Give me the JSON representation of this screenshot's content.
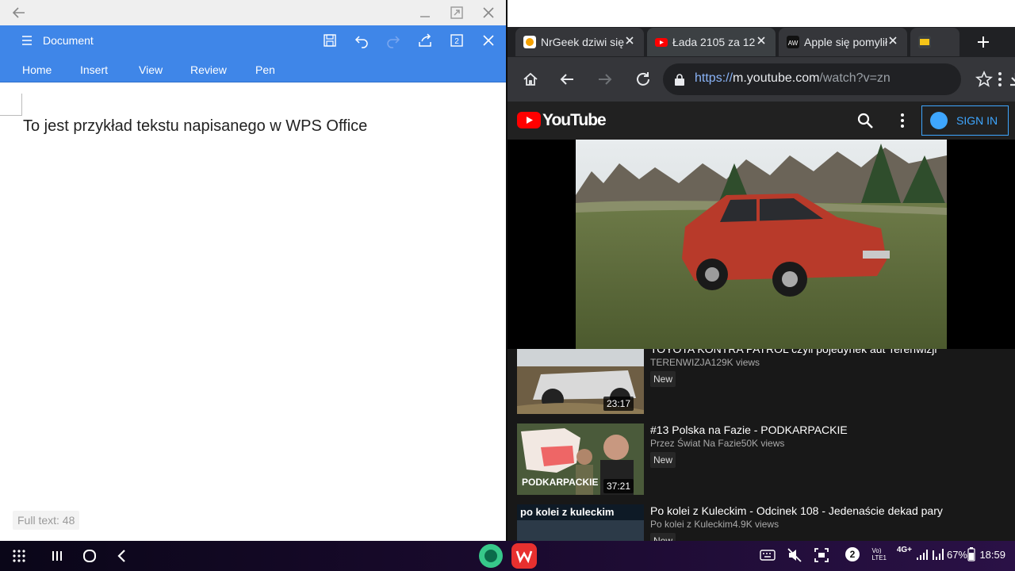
{
  "colors": {
    "wps_blue": "#3f86e8",
    "chrome_dark": "#202124",
    "yt_red": "#ff0000",
    "signin_blue": "#3ea6ff"
  },
  "wps": {
    "title": "Document",
    "tabs": [
      "Home",
      "Insert",
      "View",
      "Review",
      "Pen"
    ],
    "document_text": "To jest przykład tekstu napisanego w WPS Office",
    "full_text_label": "Full text: 48",
    "page_count_badge": "2"
  },
  "chrome": {
    "tabs": [
      {
        "label": "NrGeek dziwi się",
        "active": false
      },
      {
        "label": "Łada 2105 za 12",
        "active": true
      },
      {
        "label": "Apple się pomylił",
        "active": false
      },
      {
        "label": "",
        "active": false
      }
    ],
    "url": {
      "scheme": "https://",
      "host": "m.youtube.com",
      "path": "/watch?v=zn"
    }
  },
  "youtube": {
    "brand": "YouTube",
    "signin_label": "SIGN IN",
    "videos": [
      {
        "title": "TOYOTA KONTRA PATROL czyli pojedynek aut Terenwizji",
        "meta": "TERENWIZJA129K views",
        "badge": "New",
        "duration": "23:17"
      },
      {
        "title": "#13 Polska na Fazie - PODKARPACKIE",
        "meta": "Przez Świat Na Fazie50K views",
        "badge": "New",
        "duration": "37:21"
      },
      {
        "title": "Po kolei z Kuleckim - Odcinek 108 - Jedenaście dekad pary",
        "meta": "Po kolei z Kuleckim4.9K views",
        "badge": "New",
        "duration": ""
      }
    ],
    "thumb_texts": {
      "podkarpackie": "PODKARPACKIE",
      "kuleckim": "po kolei z kuleckim"
    }
  },
  "system": {
    "battery": "67%",
    "time": "18:59",
    "notification_count": "2",
    "network": "4G+"
  }
}
